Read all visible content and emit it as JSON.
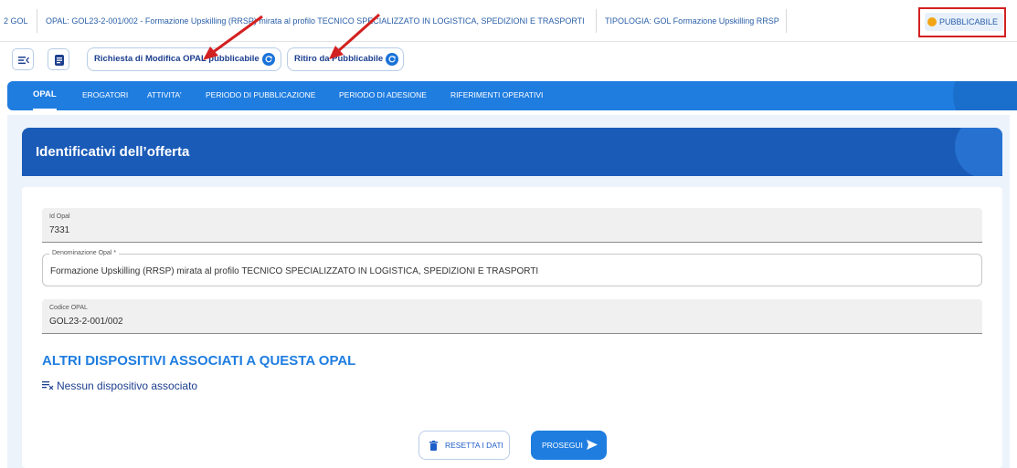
{
  "infobar": {
    "cell1": "2 GOL",
    "cell2": "OPAL: GOL23-2-001/002 - Formazione Upskilling (RRSP) mirata al profilo TECNICO SPECIALIZZATO IN LOGISTICA, SPEDIZIONI E TRASPORTI",
    "cell3": "TIPOLOGIA: GOL Formazione Upskilling RRSP",
    "status": "PUBBLICABILE"
  },
  "actions": {
    "modify_label": "Richiesta di Modifica OPAL pubblicabile",
    "withdraw_label": "Ritiro da Pubblicabile"
  },
  "tabs": [
    {
      "label": "OPAL"
    },
    {
      "label": "EROGATORI"
    },
    {
      "label": "ATTIVITA'"
    },
    {
      "label": "PERIODO DI PUBBLICAZIONE"
    },
    {
      "label": "PERIODO DI ADESIONE"
    },
    {
      "label": "RIFERIMENTI OPERATIVI"
    }
  ],
  "card": {
    "title": "Identificativi dell’offerta"
  },
  "fields": {
    "id_label": "Id Opal",
    "id_value": "7331",
    "denom_label": "Denominazione Opal *",
    "denom_value": "Formazione Upskilling (RRSP) mirata al profilo TECNICO SPECIALIZZATO IN LOGISTICA, SPEDIZIONI E TRASPORTI",
    "code_label": "Codice OPAL",
    "code_value": "GOL23-2-001/002"
  },
  "devices": {
    "title": "ALTRI DISPOSITIVI ASSOCIATI A QUESTA OPAL",
    "empty": "Nessun dispositivo associato"
  },
  "buttons": {
    "reset": "RESETTA I DATI",
    "next": "PROSEGUI"
  },
  "colors": {
    "primary": "#1f7de0",
    "header": "#1a5bb8",
    "status_dot": "#f2a515",
    "annotation": "#d32020"
  }
}
